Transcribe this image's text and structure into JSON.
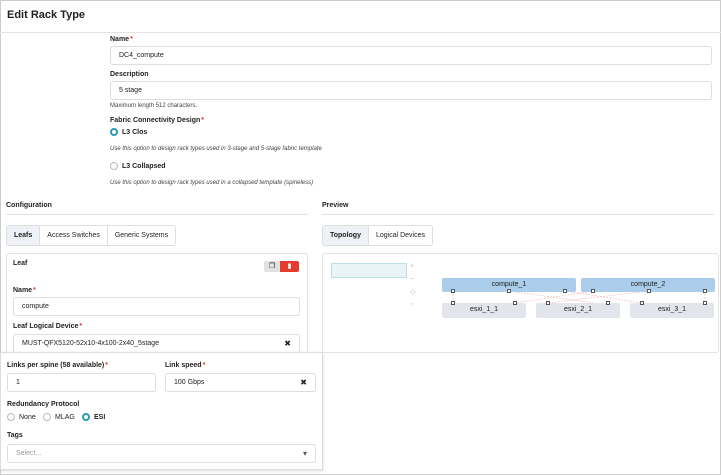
{
  "header": {
    "title": "Edit Rack Type"
  },
  "form": {
    "name_label": "Name",
    "name_value": "DC4_compute",
    "description_label": "Description",
    "description_value": "5 stage",
    "description_hint": "Maximum length 512 characters.",
    "fabric_label": "Fabric Connectivity Design",
    "l3clos_label": "L3 Clos",
    "l3clos_hint": "Use this option to design rack types used in 3-stage and 5-stage fabric template",
    "l3collapsed_label": "L3 Collapsed",
    "l3collapsed_hint": "Use this option to design rack types used in a collapsed template (spineless)"
  },
  "configuration": {
    "title": "Configuration",
    "tabs": [
      "Leafs",
      "Access Switches",
      "Generic Systems"
    ],
    "leaf_title": "Leaf",
    "name_label": "Name",
    "name_value": "compute",
    "device_label": "Leaf Logical Device",
    "device_value": "MUST-QFX5120-52x10-4x100-2x40_5stage",
    "links_label": "Links per spine (58 available)",
    "links_value": "1",
    "speed_label": "Link speed",
    "speed_value": "100 Gbps",
    "redundancy_label": "Redundancy Protocol",
    "redundancy_options": [
      "None",
      "MLAG",
      "ESI"
    ],
    "redundancy_selected": "ESI",
    "tags_label": "Tags",
    "tags_placeholder": "Select..."
  },
  "preview": {
    "title": "Preview",
    "tabs": [
      "Topology",
      "Logical Devices"
    ],
    "leafs": [
      "compute_1",
      "compute_2"
    ],
    "servers": [
      "esxi_1_1",
      "esxi_2_1",
      "esxi_3_1"
    ]
  }
}
